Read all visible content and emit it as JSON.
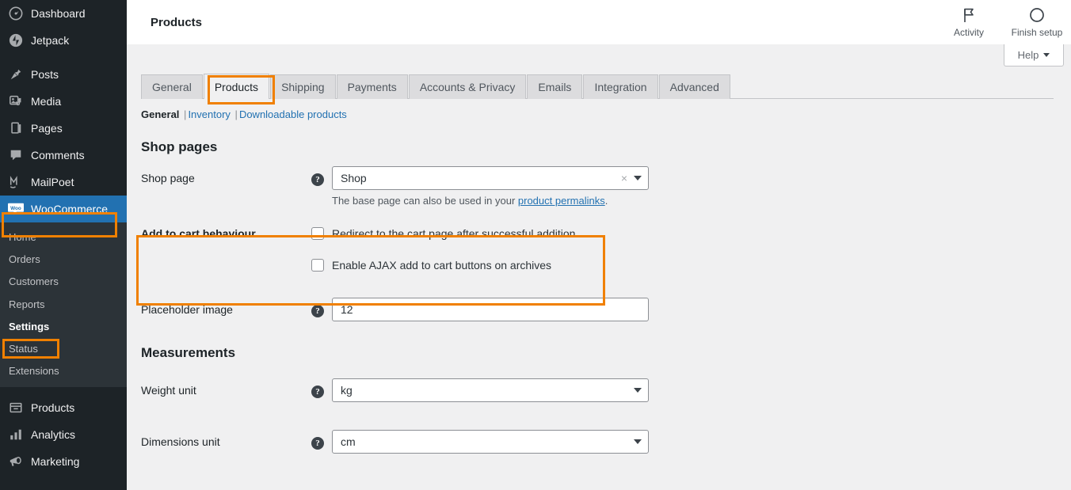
{
  "sidebar": {
    "items": [
      {
        "label": "Dashboard",
        "icon": "dashboard-icon"
      },
      {
        "label": "Jetpack",
        "icon": "jetpack-icon"
      },
      {
        "label": "Posts",
        "icon": "pin-icon"
      },
      {
        "label": "Media",
        "icon": "media-icon"
      },
      {
        "label": "Pages",
        "icon": "pages-icon"
      },
      {
        "label": "Comments",
        "icon": "comments-icon"
      },
      {
        "label": "MailPoet",
        "icon": "mailpoet-icon"
      },
      {
        "label": "WooCommerce",
        "icon": "woocommerce-icon"
      }
    ],
    "submenu": [
      {
        "label": "Home"
      },
      {
        "label": "Orders"
      },
      {
        "label": "Customers"
      },
      {
        "label": "Reports"
      },
      {
        "label": "Settings"
      },
      {
        "label": "Status"
      },
      {
        "label": "Extensions"
      }
    ],
    "bottom_items": [
      {
        "label": "Products",
        "icon": "products-icon"
      },
      {
        "label": "Analytics",
        "icon": "analytics-icon"
      },
      {
        "label": "Marketing",
        "icon": "marketing-icon"
      }
    ]
  },
  "topbar": {
    "title": "Products",
    "activity_label": "Activity",
    "finish_setup_label": "Finish setup",
    "help_label": "Help"
  },
  "tabs": [
    {
      "label": "General",
      "active": false
    },
    {
      "label": "Products",
      "active": true
    },
    {
      "label": "Shipping",
      "active": false
    },
    {
      "label": "Payments",
      "active": false
    },
    {
      "label": "Accounts & Privacy",
      "active": false
    },
    {
      "label": "Emails",
      "active": false
    },
    {
      "label": "Integration",
      "active": false
    },
    {
      "label": "Advanced",
      "active": false
    }
  ],
  "subnav": {
    "current": "General",
    "inventory": "Inventory",
    "downloadable": "Downloadable products",
    "separator": "|"
  },
  "sections": {
    "shop_pages_title": "Shop pages",
    "measurements_title": "Measurements"
  },
  "fields": {
    "shop_page": {
      "label": "Shop page",
      "value": "Shop",
      "clear_glyph": "×",
      "hint_before": "The base page can also be used in your ",
      "hint_link": "product permalinks",
      "hint_after": "."
    },
    "add_to_cart": {
      "label": "Add to cart behaviour",
      "checkbox1": "Redirect to the cart page after successful addition",
      "checkbox1_checked": false,
      "checkbox2": "Enable AJAX add to cart buttons on archives",
      "checkbox2_checked": false
    },
    "placeholder_image": {
      "label": "Placeholder image",
      "value": "12"
    },
    "weight_unit": {
      "label": "Weight unit",
      "value": "kg"
    },
    "dimensions_unit": {
      "label": "Dimensions unit",
      "value": "cm"
    }
  },
  "help_tip_glyph": "?",
  "colors": {
    "sidebar_bg": "#1d2327",
    "submenu_bg": "#2c3338",
    "current_menu": "#2271b1",
    "highlight": "#f08000",
    "content_bg": "#f0f0f1",
    "link": "#2271b1"
  }
}
